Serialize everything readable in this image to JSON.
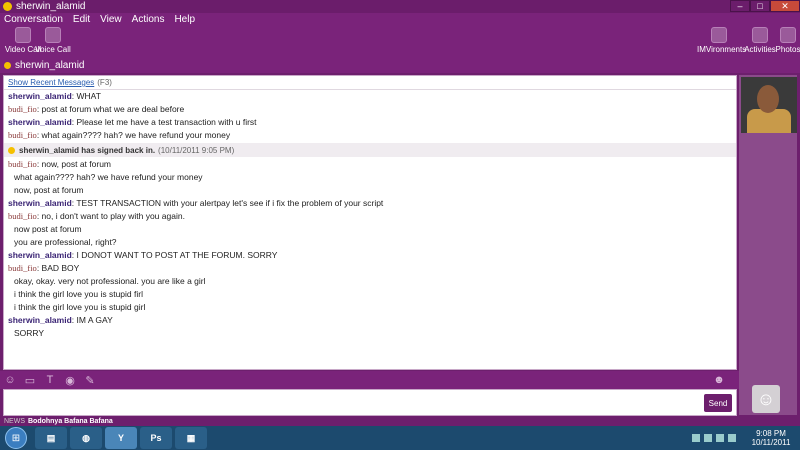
{
  "window": {
    "title": "sherwin_alamid",
    "min": "–",
    "max": "□",
    "close": "✕"
  },
  "menu": [
    "Conversation",
    "Edit",
    "View",
    "Actions",
    "Help"
  ],
  "toolbar": {
    "video_call": "Video Call",
    "voice_call": "Voice Call",
    "imwebcam": "IMVironments",
    "activities": "Activities",
    "photos": "Photos"
  },
  "contact": {
    "name": "sherwin_alamid"
  },
  "chat": {
    "show_recent": "Show Recent Messages",
    "shortcut": "(F3)",
    "messages": [
      {
        "sender": "sherwin_alamid",
        "text": "WHAT"
      },
      {
        "sender": "budi_fio",
        "text": "post at forum what we are deal before"
      },
      {
        "sender": "sherwin_alamid",
        "text": "Please let me have a test transaction with u first"
      },
      {
        "sender": "budi_fio",
        "text": "what again???? hah? we have refund your money"
      }
    ],
    "notice": {
      "text": "sherwin_alamid has signed back in.",
      "time": "(10/11/2011 9:05 PM)"
    },
    "messages2": [
      {
        "sender": "budi_fio",
        "text": "now, post at forum"
      },
      {
        "cont": "what again???? hah? we have refund your money"
      },
      {
        "cont": "now, post at forum"
      },
      {
        "sender": "sherwin_alamid",
        "text": "TEST TRANSACTION with your alertpay let's see if i fix the problem of your script"
      },
      {
        "sender": "budi_fio",
        "text": "no, i don't want to play with you again."
      },
      {
        "cont": "now post at forum"
      },
      {
        "cont": "you are professional, right?"
      },
      {
        "sender": "sherwin_alamid",
        "text": "I DONOT WANT TO POST AT THE FORUM. SORRY"
      },
      {
        "sender": "budi_fio",
        "text": "BAD BOY"
      },
      {
        "cont": "okay, okay. very not professional. you are like a girl"
      },
      {
        "cont": "i think the girl love you is stupid firl"
      },
      {
        "cont": "i think the girl love you is stupid girl"
      },
      {
        "sender": "sherwin_alamid",
        "text": "IM A GAY"
      },
      {
        "cont": "SORRY"
      }
    ]
  },
  "input": {
    "send": "Send"
  },
  "news": {
    "label": "NEWS",
    "text": "Bodohnya Bafana Bafana"
  },
  "taskbar": {
    "ps": "Ps",
    "time": "9:08 PM",
    "date": "10/11/2011"
  },
  "colors": {
    "accent": "#6d1f6d",
    "sender": "#3b2575",
    "budi": "#8a3a3a"
  }
}
